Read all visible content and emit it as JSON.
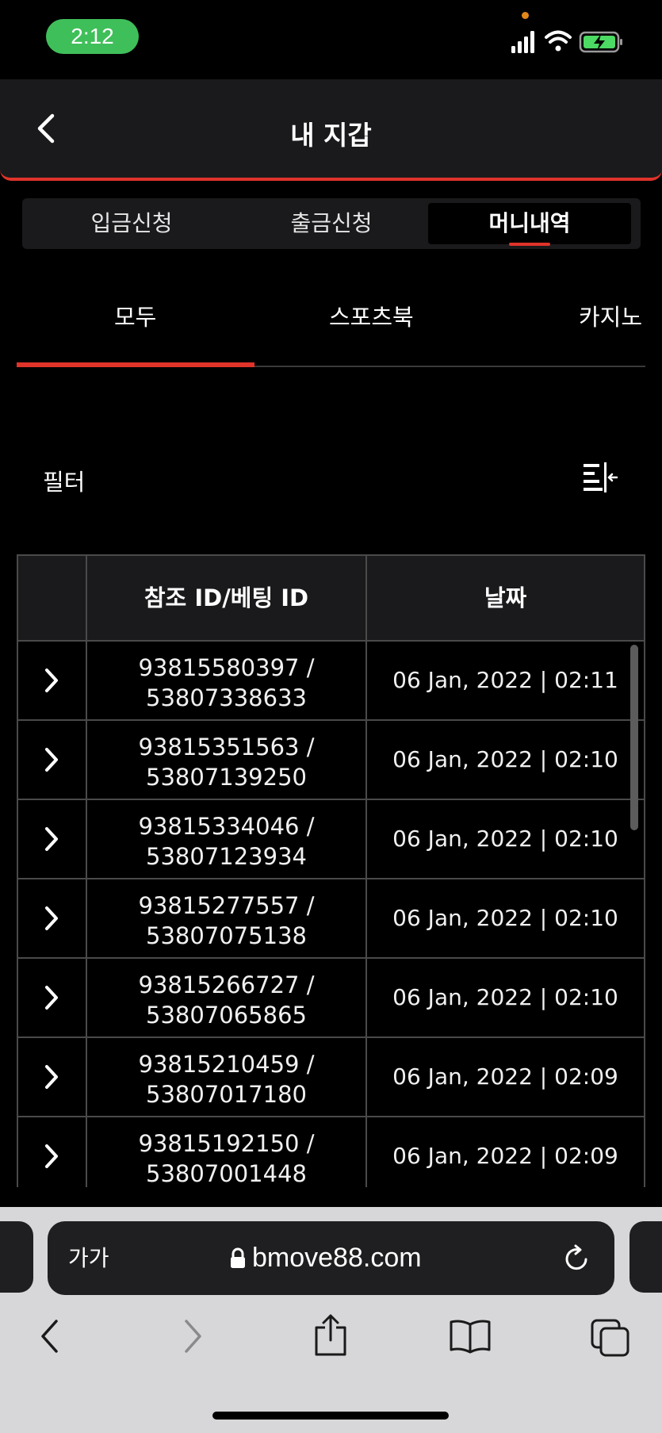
{
  "status_bar": {
    "time": "2:12"
  },
  "header": {
    "title": "내 지갑"
  },
  "segments": [
    {
      "label": "입금신청"
    },
    {
      "label": "출금신청"
    },
    {
      "label": "머니내역"
    }
  ],
  "category_tabs": [
    {
      "label": "모두"
    },
    {
      "label": "스포츠북"
    },
    {
      "label": "카지노"
    }
  ],
  "filter": {
    "label": "필터"
  },
  "table": {
    "headers": [
      "",
      "참조 ID/베팅 ID",
      "날짜"
    ],
    "rows": [
      {
        "ref1": "93815580397 /",
        "ref2": "53807338633",
        "date": "06 Jan, 2022 | 02:11"
      },
      {
        "ref1": "93815351563 /",
        "ref2": "53807139250",
        "date": "06 Jan, 2022 | 02:10"
      },
      {
        "ref1": "93815334046 /",
        "ref2": "53807123934",
        "date": "06 Jan, 2022 | 02:10"
      },
      {
        "ref1": "93815277557 /",
        "ref2": "53807075138",
        "date": "06 Jan, 2022 | 02:10"
      },
      {
        "ref1": "93815266727 /",
        "ref2": "53807065865",
        "date": "06 Jan, 2022 | 02:10"
      },
      {
        "ref1": "93815210459 /",
        "ref2": "53807017180",
        "date": "06 Jan, 2022 | 02:09"
      },
      {
        "ref1": "93815192150 /",
        "ref2": "53807001448",
        "date": "06 Jan, 2022 | 02:09"
      }
    ]
  },
  "browser": {
    "text_size_label": "가가",
    "url": "bmove88.com"
  },
  "colors": {
    "accent": "#e0332a",
    "status_green": "#3fbf5a",
    "panel": "#1a1a1c"
  }
}
